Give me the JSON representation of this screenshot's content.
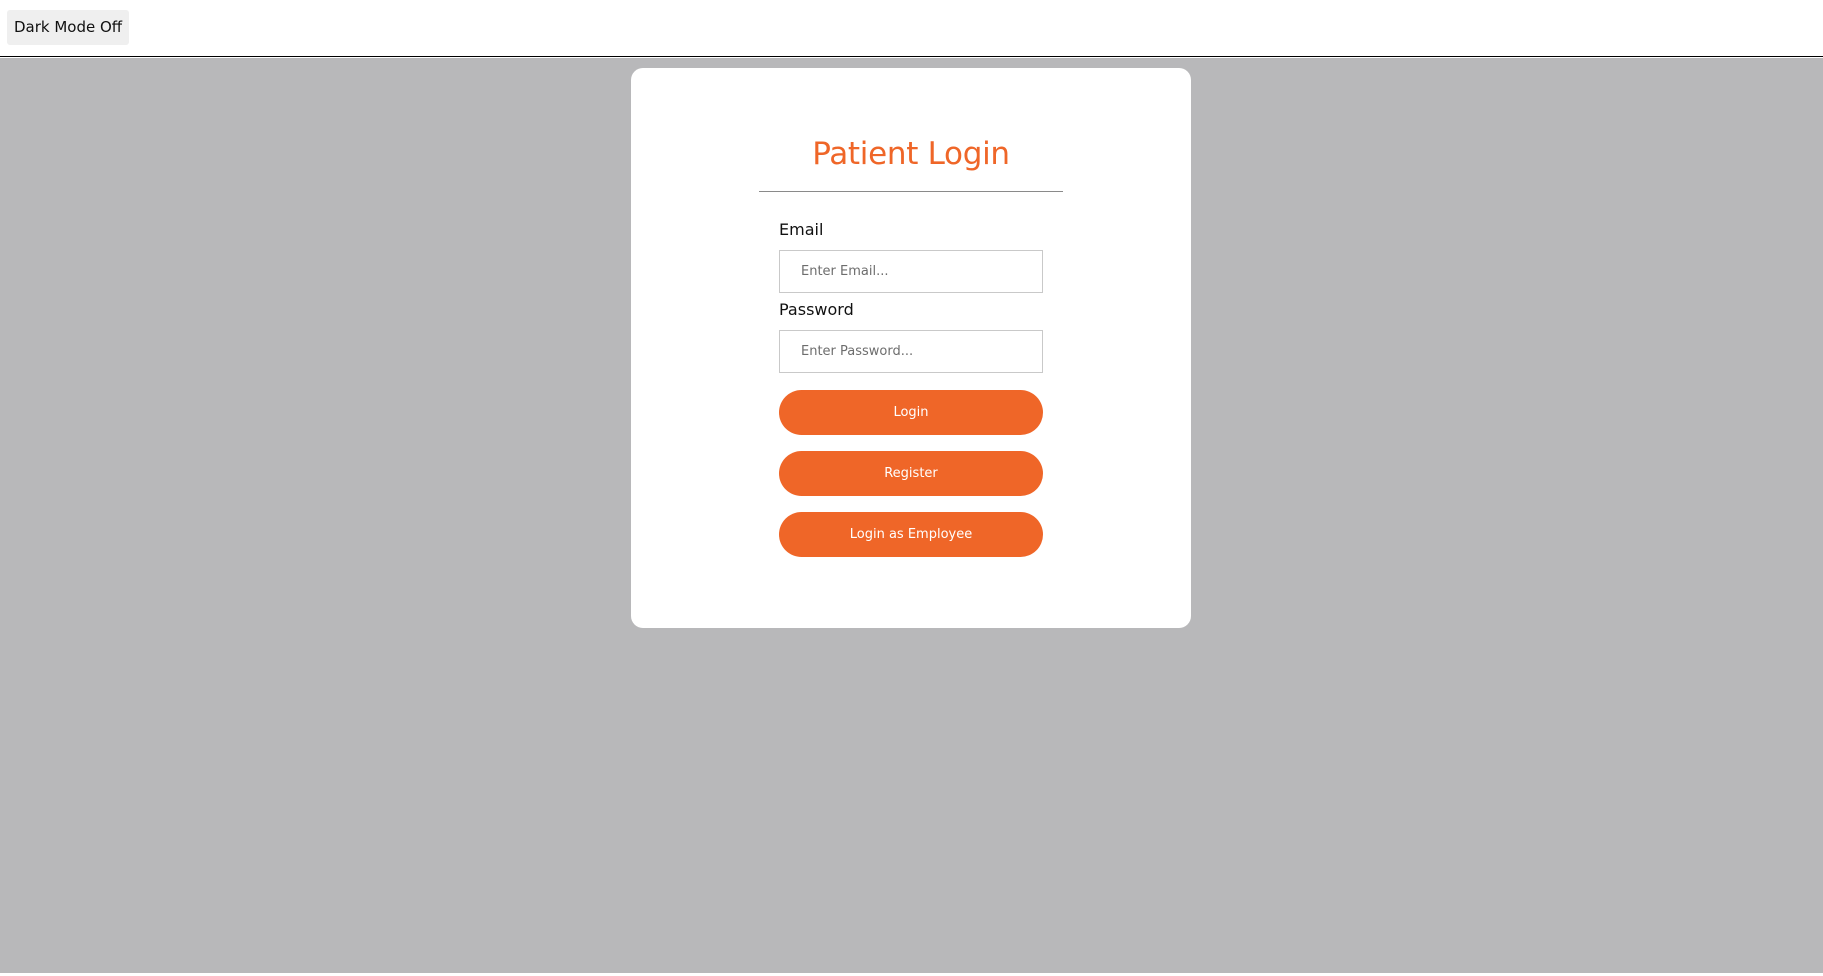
{
  "topbar": {
    "dark_mode_label": "Dark Mode Off"
  },
  "login_card": {
    "title": "Patient Login",
    "email": {
      "label": "Email",
      "placeholder": "Enter Email...",
      "value": ""
    },
    "password": {
      "label": "Password",
      "placeholder": "Enter Password...",
      "value": ""
    },
    "buttons": {
      "login": "Login",
      "register": "Register",
      "login_employee": "Login as Employee"
    }
  },
  "colors": {
    "accent": "#ef6628",
    "page_background": "#b8b8ba",
    "card_background": "#ffffff",
    "toggle_background": "#efefef"
  }
}
